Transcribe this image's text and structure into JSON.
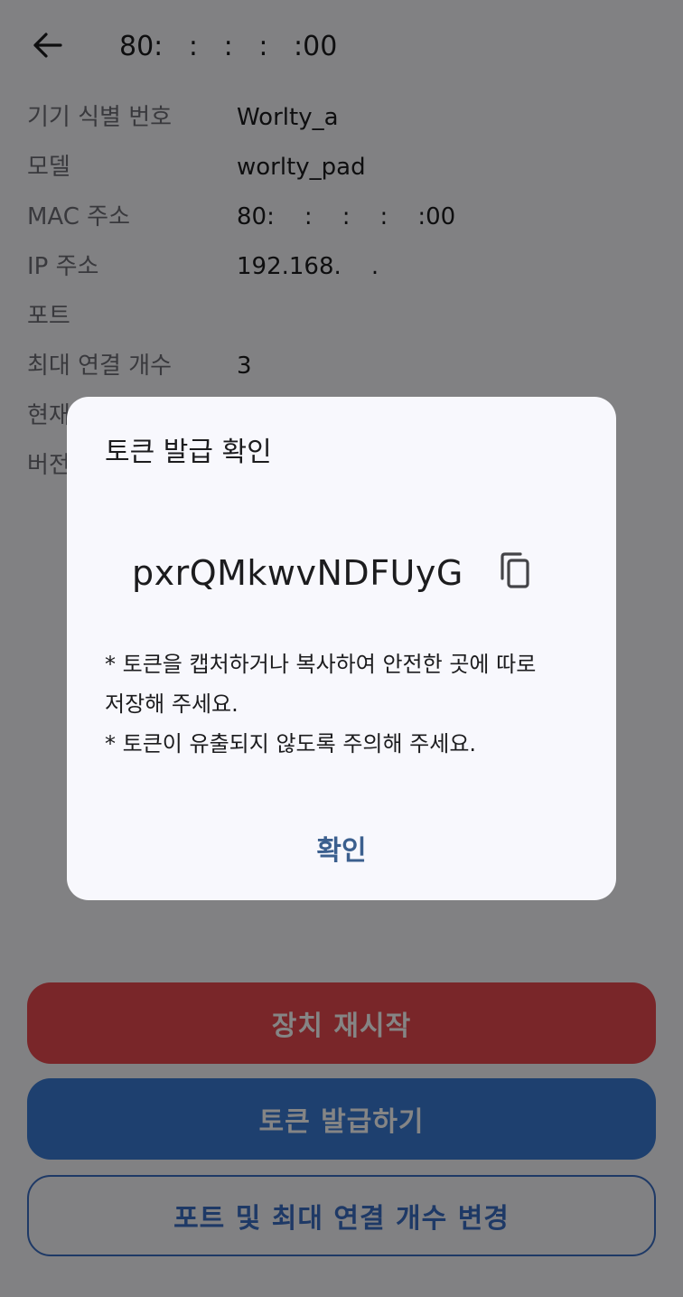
{
  "header": {
    "back_icon": "arrow-left-icon",
    "title": "80:   :   :   :   :00"
  },
  "info": [
    {
      "label": "기기 식별 번호",
      "value": "Worlty_a"
    },
    {
      "label": "모델",
      "value": "worlty_pad"
    },
    {
      "label": "MAC 주소",
      "value": "80:    :    :    :    :00"
    },
    {
      "label": "IP 주소",
      "value": "192.168.    ."
    },
    {
      "label": "포트",
      "value": ""
    },
    {
      "label": "최대 연결 개수",
      "value": "3"
    },
    {
      "label": "현재",
      "value": ""
    },
    {
      "label": "버전",
      "value": ""
    }
  ],
  "buttons": {
    "restart": "장치 재시작",
    "issue_token": "토큰 발급하기",
    "change_port": "포트 및 최대 연결 개수 변경"
  },
  "dialog": {
    "title": "토큰 발급 확인",
    "token": "pxrQMkwvNDFUyG",
    "copy_icon": "copy-icon",
    "notice_lines": [
      "* 토큰을 캡처하거나 복사하여 안전한 곳에 따로 저장해 주세요.",
      "* 토큰이 유출되지 않도록 주의해 주세요."
    ],
    "confirm": "확인"
  },
  "colors": {
    "restart_button": "#e84a4f",
    "token_button": "#3a7bd5",
    "outline_button": "#3a6dc4",
    "dialog_confirm": "#3b5f8e",
    "background": "#f7f7fb"
  }
}
